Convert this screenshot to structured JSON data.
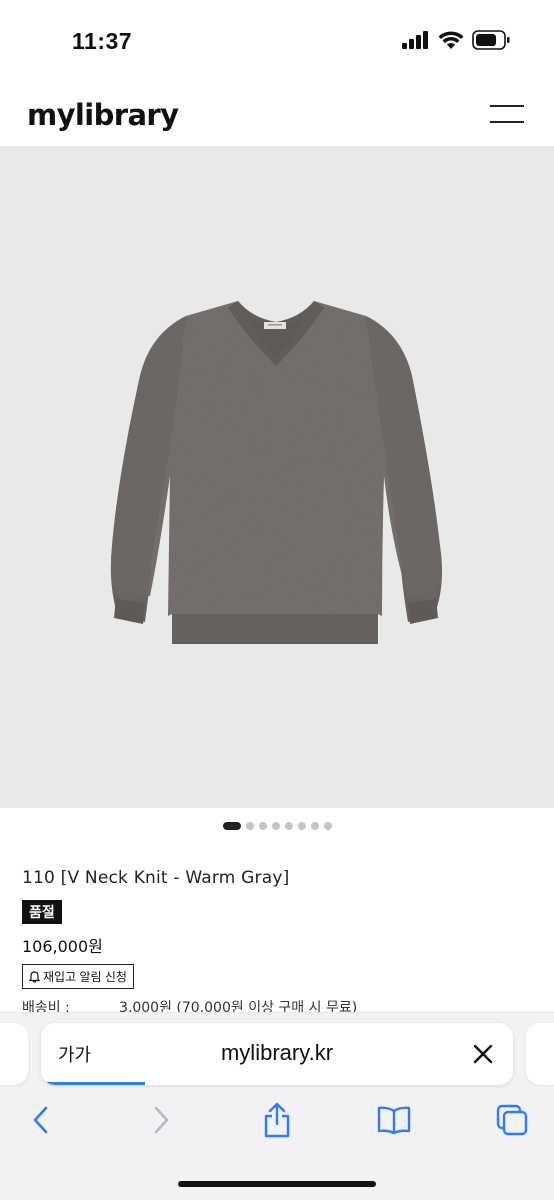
{
  "status_bar": {
    "time": "11:37"
  },
  "header": {
    "logo": "mylibrary",
    "menu_icon": "hamburger-icon"
  },
  "product_image": {
    "description_icon": "sweater-image",
    "sweater_color": "#6f6a67",
    "background": "#e9e9e9"
  },
  "carousel": {
    "total": 8,
    "active_index": 0
  },
  "product": {
    "name": "110 [V Neck Knit - Warm Gray]",
    "badge": "품절",
    "price": "106,000원",
    "restock_label": "재입고 알림 신청",
    "shipping_label": "배송비 :",
    "shipping_value": "3,000원 (70,000원 이상 구매 시 무료)"
  },
  "browser": {
    "text_size_label": "가가",
    "url": "mylibrary.kr",
    "accent": "#2d7cf6",
    "load_progress": 0.22
  }
}
